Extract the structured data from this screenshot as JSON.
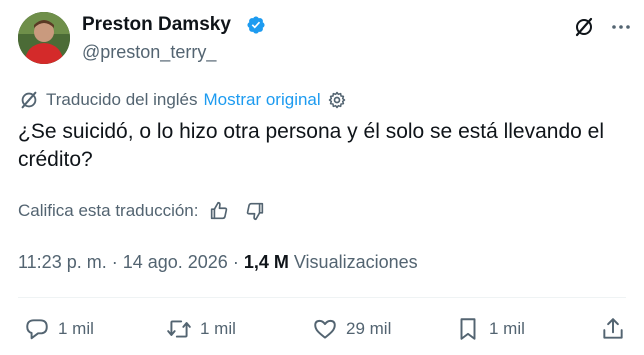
{
  "author": {
    "display_name": "Preston Damsky",
    "handle": "@preston_terry_",
    "verified": true
  },
  "translation": {
    "label": "Traducido del inglés",
    "show_original": "Mostrar original"
  },
  "tweet": {
    "text": "¿Se suicidó, o lo hizo otra persona y él solo se está llevando el crédito?"
  },
  "rate": {
    "label": "Califica esta traducción:"
  },
  "meta": {
    "time": "11:23 p. m.",
    "sep1": " · ",
    "date": "14 ago. 2026",
    "sep2": " · ",
    "views_count": "1,4 M",
    "views_label": "Visualizaciones"
  },
  "actions": {
    "replies": "1 mil",
    "reposts": "1 mil",
    "likes": "29 mil",
    "bookmarks": "1 mil"
  },
  "colors": {
    "accent": "#1d9bf0",
    "secondary_text": "#536471",
    "primary_text": "#0f1419"
  }
}
